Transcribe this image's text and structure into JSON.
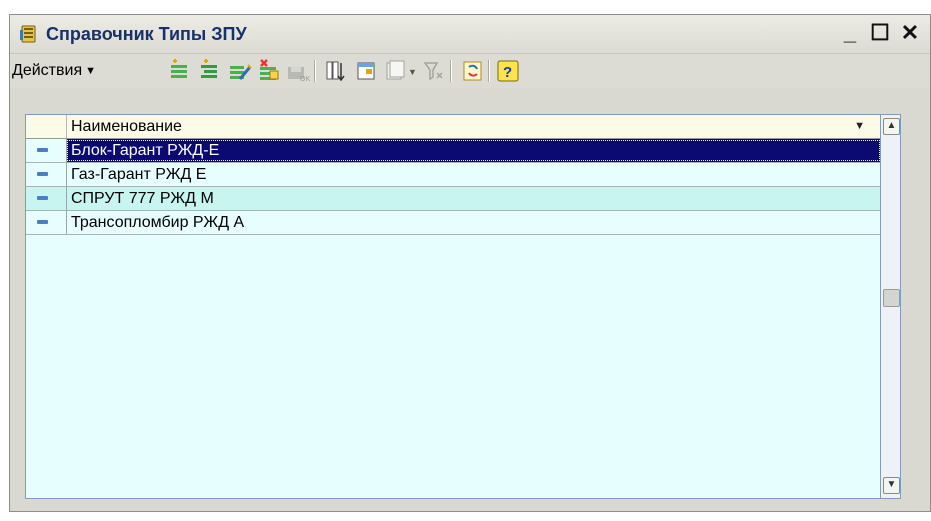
{
  "window": {
    "title": "Справочник Типы ЗПУ",
    "controls": {
      "minimize": "_",
      "maximize": "☐",
      "close": "✕"
    }
  },
  "toolbar": {
    "actions_label": "Действия",
    "icons": [
      "add-icon",
      "add-group-icon",
      "edit-icon",
      "delete-icon",
      "save-icon",
      "filter-icon",
      "filter-settings-icon",
      "filter-history-icon",
      "clear-filter-icon",
      "refresh-icon",
      "help-icon"
    ]
  },
  "table": {
    "header": "Наименование",
    "rows": [
      {
        "name": "Блок-Гарант РЖД-Е",
        "selected": true
      },
      {
        "name": "Газ-Гарант РЖД Е",
        "selected": false
      },
      {
        "name": "СПРУТ 777 РЖД М",
        "selected": false
      },
      {
        "name": "Трансопломбир РЖД А",
        "selected": false
      }
    ]
  },
  "colors": {
    "selection": "#0b0a72",
    "row_bg": "#e6fffe",
    "row_alt": "#c9f5f1",
    "title_text": "#17326a"
  }
}
